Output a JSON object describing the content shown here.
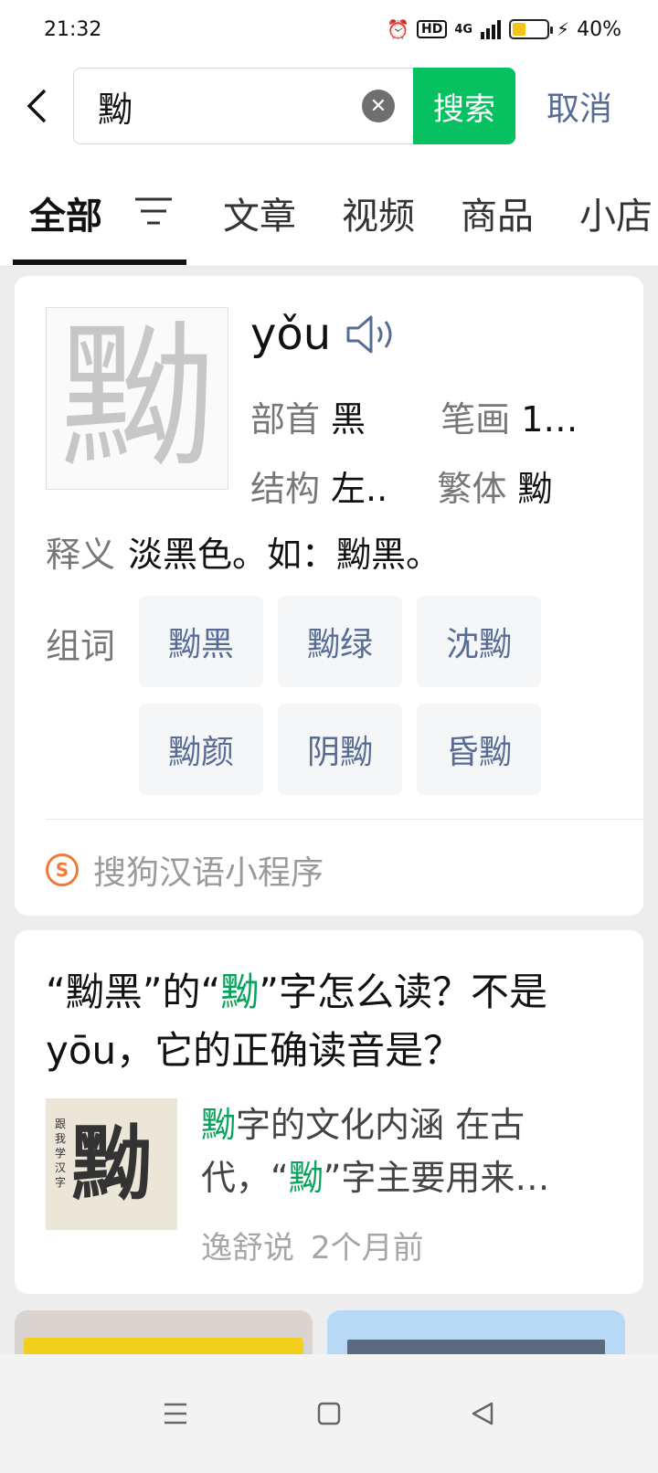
{
  "status_bar": {
    "time": "21:32",
    "hd_label": "HD",
    "network": "4G",
    "battery_text": "40%",
    "battery_level": 0.4,
    "icons": [
      "alarm-icon",
      "hd-icon",
      "signal-icon",
      "battery-icon",
      "charging-icon"
    ]
  },
  "search": {
    "query": "黝",
    "button_label": "搜索",
    "cancel_label": "取消"
  },
  "tabs": [
    {
      "label": "全部",
      "active": true
    },
    {
      "label": "文章",
      "active": false
    },
    {
      "label": "视频",
      "active": false
    },
    {
      "label": "商品",
      "active": false
    },
    {
      "label": "小店",
      "active": false
    }
  ],
  "dictionary": {
    "character": "黝",
    "pinyin": "yǒu",
    "radical_label": "部首",
    "radical_value": "黑",
    "strokes_label": "笔画",
    "strokes_value": "1…",
    "structure_label": "结构",
    "structure_value": "左..",
    "traditional_label": "繁体",
    "traditional_value": "黝",
    "definition_label": "释义",
    "definition_value": "淡黑色。如：黝黑。",
    "words_label": "组词",
    "words": [
      "黝黑",
      "黝绿",
      "沈黝",
      "黝颜",
      "阴黝",
      "昏黝"
    ],
    "source_logo": "S",
    "source": "搜狗汉语小程序"
  },
  "article": {
    "title_parts": [
      "“黝黑”的“",
      "黝",
      "”字怎么读？不是yōu，它的正确读音是？"
    ],
    "thumb_char": "黝",
    "thumb_side": "跟我学汉字",
    "snippet_line1_hl": "黝",
    "snippet_line1": "字的文化内涵 在古",
    "snippet_line2_a": "代，“",
    "snippet_line2_hl": "黝",
    "snippet_line2_b": "”字主要用来…",
    "author": "逸舒说",
    "time": "2个月前"
  },
  "colors": {
    "accent_green": "#07c160",
    "link_blue": "#576b95",
    "highlight_green": "#07a35a"
  }
}
